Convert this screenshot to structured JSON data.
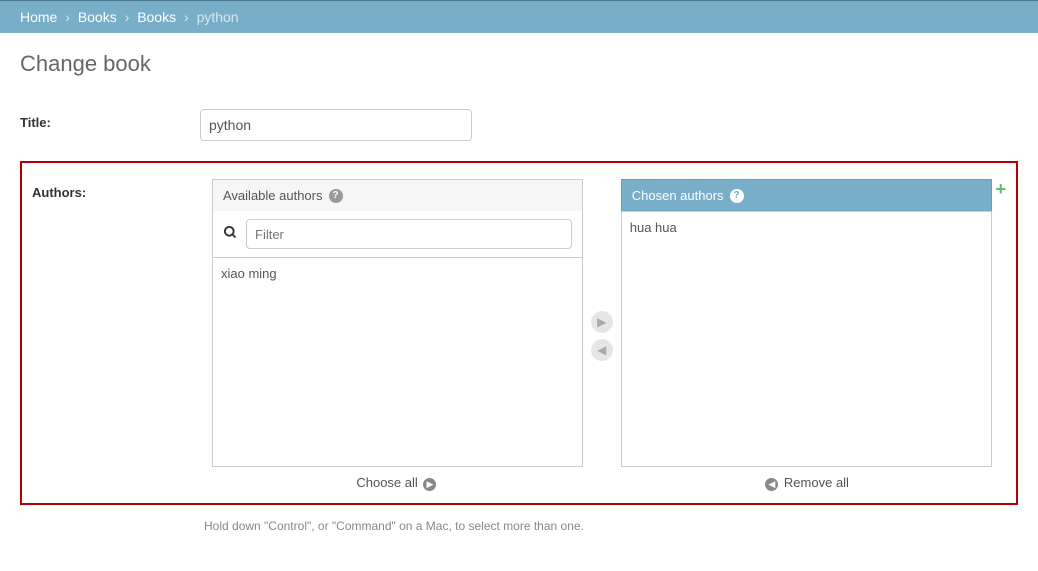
{
  "breadcrumbs": {
    "home": "Home",
    "app": "Books",
    "model": "Books",
    "current": "python"
  },
  "page_title": "Change book",
  "fields": {
    "title": {
      "label": "Title:",
      "value": "python"
    },
    "authors": {
      "label": "Authors:",
      "available_header": "Available authors",
      "chosen_header": "Chosen authors",
      "filter_placeholder": "Filter",
      "available_items": [
        "xiao ming"
      ],
      "chosen_items": [
        "hua hua"
      ],
      "choose_all": "Choose all",
      "remove_all": "Remove all",
      "help_text": "Hold down \"Control\", or \"Command\" on a Mac, to select more than one."
    }
  }
}
